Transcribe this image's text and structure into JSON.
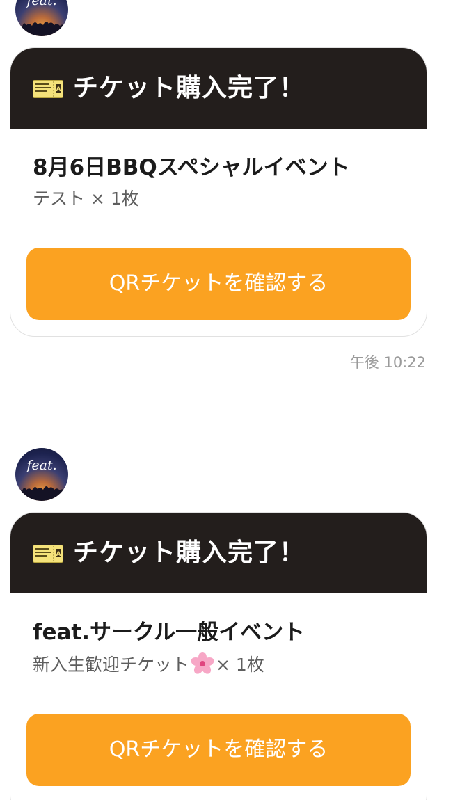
{
  "chat": {
    "messages": [
      {
        "header_title": "チケット購入完了！",
        "event_name": "8月6日BBQスペシャルイベント",
        "ticket_text": "テスト × 1枚",
        "button_label": "QRチケットを確認する"
      },
      {
        "header_title": "チケット購入完了！",
        "event_name": "feat.サークル一般イベント",
        "ticket_name": "新入生歓迎チケット",
        "ticket_qty": "× 1枚",
        "button_label": "QRチケットを確認する"
      }
    ],
    "timestamp": "午後 10:22",
    "avatar_brand": "feat."
  },
  "colors": {
    "header_bg": "#231e1c",
    "button_bg": "#fba221",
    "card_border": "#e1e1e1",
    "timestamp_text": "#9a9a9a"
  },
  "icons": {
    "ticket": "ticket-icon",
    "flower": "cherry-blossom-icon"
  }
}
